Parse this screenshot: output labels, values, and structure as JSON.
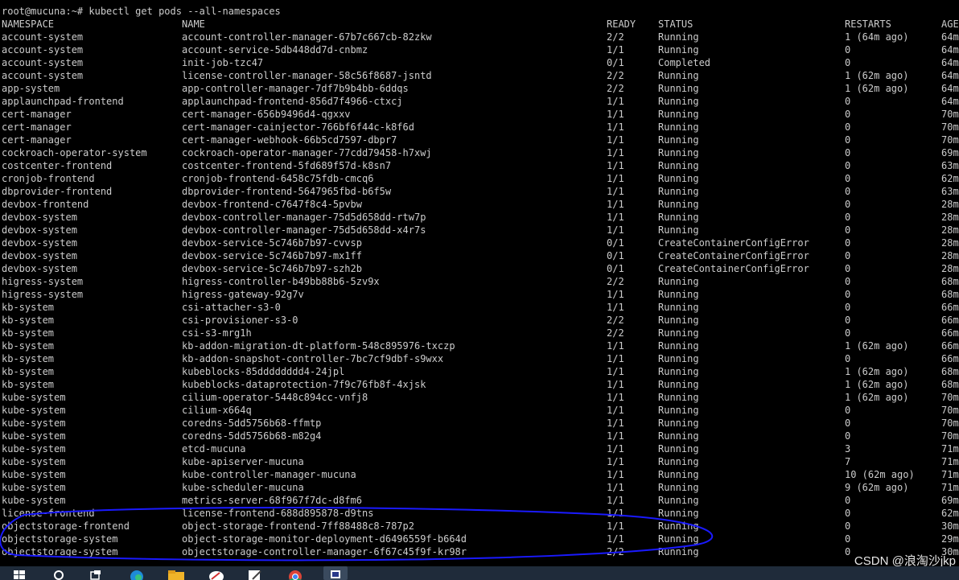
{
  "terminal": {
    "prompt": "root@mucuna:~# kubectl get pods --all-namespaces",
    "headers": {
      "namespace": "NAMESPACE",
      "name": "NAME",
      "ready": "READY",
      "status": "STATUS",
      "restarts": "RESTARTS",
      "age": "AGE"
    },
    "rows": [
      {
        "namespace": "account-system",
        "name": "account-controller-manager-67b7c667cb-82zkw",
        "ready": "2/2",
        "status": "Running",
        "restarts": "1 (64m ago)",
        "age": "64m"
      },
      {
        "namespace": "account-system",
        "name": "account-service-5db448dd7d-cnbmz",
        "ready": "1/1",
        "status": "Running",
        "restarts": "0",
        "age": "64m"
      },
      {
        "namespace": "account-system",
        "name": "init-job-tzc47",
        "ready": "0/1",
        "status": "Completed",
        "restarts": "0",
        "age": "64m"
      },
      {
        "namespace": "account-system",
        "name": "license-controller-manager-58c56f8687-jsntd",
        "ready": "2/2",
        "status": "Running",
        "restarts": "1 (62m ago)",
        "age": "64m"
      },
      {
        "namespace": "app-system",
        "name": "app-controller-manager-7df7b9b4bb-6ddqs",
        "ready": "2/2",
        "status": "Running",
        "restarts": "1 (62m ago)",
        "age": "64m"
      },
      {
        "namespace": "applaunchpad-frontend",
        "name": "applaunchpad-frontend-856d7f4966-ctxcj",
        "ready": "1/1",
        "status": "Running",
        "restarts": "0",
        "age": "64m"
      },
      {
        "namespace": "cert-manager",
        "name": "cert-manager-656b9496d4-qgxxv",
        "ready": "1/1",
        "status": "Running",
        "restarts": "0",
        "age": "70m"
      },
      {
        "namespace": "cert-manager",
        "name": "cert-manager-cainjector-766bf6f44c-k8f6d",
        "ready": "1/1",
        "status": "Running",
        "restarts": "0",
        "age": "70m"
      },
      {
        "namespace": "cert-manager",
        "name": "cert-manager-webhook-66b5cd7597-dbpr7",
        "ready": "1/1",
        "status": "Running",
        "restarts": "0",
        "age": "70m"
      },
      {
        "namespace": "cockroach-operator-system",
        "name": "cockroach-operator-manager-77cdd79458-h7xwj",
        "ready": "1/1",
        "status": "Running",
        "restarts": "0",
        "age": "69m"
      },
      {
        "namespace": "costcenter-frontend",
        "name": "costcenter-frontend-5fd689f57d-k8sn7",
        "ready": "1/1",
        "status": "Running",
        "restarts": "0",
        "age": "63m"
      },
      {
        "namespace": "cronjob-frontend",
        "name": "cronjob-frontend-6458c75fdb-cmcq6",
        "ready": "1/1",
        "status": "Running",
        "restarts": "0",
        "age": "62m"
      },
      {
        "namespace": "dbprovider-frontend",
        "name": "dbprovider-frontend-5647965fbd-b6f5w",
        "ready": "1/1",
        "status": "Running",
        "restarts": "0",
        "age": "63m"
      },
      {
        "namespace": "devbox-frontend",
        "name": "devbox-frontend-c7647f8c4-5pvbw",
        "ready": "1/1",
        "status": "Running",
        "restarts": "0",
        "age": "28m"
      },
      {
        "namespace": "devbox-system",
        "name": "devbox-controller-manager-75d5d658dd-rtw7p",
        "ready": "1/1",
        "status": "Running",
        "restarts": "0",
        "age": "28m"
      },
      {
        "namespace": "devbox-system",
        "name": "devbox-controller-manager-75d5d658dd-x4r7s",
        "ready": "1/1",
        "status": "Running",
        "restarts": "0",
        "age": "28m"
      },
      {
        "namespace": "devbox-system",
        "name": "devbox-service-5c746b7b97-cvvsp",
        "ready": "0/1",
        "status": "CreateContainerConfigError",
        "restarts": "0",
        "age": "28m"
      },
      {
        "namespace": "devbox-system",
        "name": "devbox-service-5c746b7b97-mx1ff",
        "ready": "0/1",
        "status": "CreateContainerConfigError",
        "restarts": "0",
        "age": "28m"
      },
      {
        "namespace": "devbox-system",
        "name": "devbox-service-5c746b7b97-szh2b",
        "ready": "0/1",
        "status": "CreateContainerConfigError",
        "restarts": "0",
        "age": "28m"
      },
      {
        "namespace": "higress-system",
        "name": "higress-controller-b49bb88b6-5zv9x",
        "ready": "2/2",
        "status": "Running",
        "restarts": "0",
        "age": "68m"
      },
      {
        "namespace": "higress-system",
        "name": "higress-gateway-92g7v",
        "ready": "1/1",
        "status": "Running",
        "restarts": "0",
        "age": "68m"
      },
      {
        "namespace": "kb-system",
        "name": "csi-attacher-s3-0",
        "ready": "1/1",
        "status": "Running",
        "restarts": "0",
        "age": "66m"
      },
      {
        "namespace": "kb-system",
        "name": "csi-provisioner-s3-0",
        "ready": "2/2",
        "status": "Running",
        "restarts": "0",
        "age": "66m"
      },
      {
        "namespace": "kb-system",
        "name": "csi-s3-mrg1h",
        "ready": "2/2",
        "status": "Running",
        "restarts": "0",
        "age": "66m"
      },
      {
        "namespace": "kb-system",
        "name": "kb-addon-migration-dt-platform-548c895976-txczp",
        "ready": "1/1",
        "status": "Running",
        "restarts": "1 (62m ago)",
        "age": "66m"
      },
      {
        "namespace": "kb-system",
        "name": "kb-addon-snapshot-controller-7bc7cf9dbf-s9wxx",
        "ready": "1/1",
        "status": "Running",
        "restarts": "0",
        "age": "66m"
      },
      {
        "namespace": "kb-system",
        "name": "kubeblocks-85dddddddd4-24jpl",
        "ready": "1/1",
        "status": "Running",
        "restarts": "1 (62m ago)",
        "age": "68m"
      },
      {
        "namespace": "kb-system",
        "name": "kubeblocks-dataprotection-7f9c76fb8f-4xjsk",
        "ready": "1/1",
        "status": "Running",
        "restarts": "1 (62m ago)",
        "age": "68m"
      },
      {
        "namespace": "kube-system",
        "name": "cilium-operator-5448c894cc-vnfj8",
        "ready": "1/1",
        "status": "Running",
        "restarts": "1 (62m ago)",
        "age": "70m"
      },
      {
        "namespace": "kube-system",
        "name": "cilium-x664q",
        "ready": "1/1",
        "status": "Running",
        "restarts": "0",
        "age": "70m"
      },
      {
        "namespace": "kube-system",
        "name": "coredns-5dd5756b68-ffmtp",
        "ready": "1/1",
        "status": "Running",
        "restarts": "0",
        "age": "70m"
      },
      {
        "namespace": "kube-system",
        "name": "coredns-5dd5756b68-m82g4",
        "ready": "1/1",
        "status": "Running",
        "restarts": "0",
        "age": "70m"
      },
      {
        "namespace": "kube-system",
        "name": "etcd-mucuna",
        "ready": "1/1",
        "status": "Running",
        "restarts": "3",
        "age": "71m"
      },
      {
        "namespace": "kube-system",
        "name": "kube-apiserver-mucuna",
        "ready": "1/1",
        "status": "Running",
        "restarts": "7",
        "age": "71m"
      },
      {
        "namespace": "kube-system",
        "name": "kube-controller-manager-mucuna",
        "ready": "1/1",
        "status": "Running",
        "restarts": "10 (62m ago)",
        "age": "71m"
      },
      {
        "namespace": "kube-system",
        "name": "kube-scheduler-mucuna",
        "ready": "1/1",
        "status": "Running",
        "restarts": "9 (62m ago)",
        "age": "71m"
      },
      {
        "namespace": "kube-system",
        "name": "metrics-server-68f967f7dc-d8fm6",
        "ready": "1/1",
        "status": "Running",
        "restarts": "0",
        "age": "69m"
      },
      {
        "namespace": "license-frontend",
        "name": "license-frontend-688d895878-d9tns",
        "ready": "1/1",
        "status": "Running",
        "restarts": "0",
        "age": "62m"
      },
      {
        "namespace": "objectstorage-frontend",
        "name": "object-storage-frontend-7ff88488c8-787p2",
        "ready": "1/1",
        "status": "Running",
        "restarts": "0",
        "age": "30m"
      },
      {
        "namespace": "objectstorage-system",
        "name": "object-storage-monitor-deployment-d6496559f-b664d",
        "ready": "1/1",
        "status": "Running",
        "restarts": "0",
        "age": "29m"
      },
      {
        "namespace": "objectstorage-system",
        "name": "objectstorage-controller-manager-6f67c45f9f-kr98r",
        "ready": "2/2",
        "status": "Running",
        "restarts": "0",
        "age": "30m"
      }
    ]
  },
  "watermark": "CSDN @浪淘沙jkp",
  "colors": {
    "background": "#000000",
    "text": "#cccccc",
    "annotation": "#1a1aff",
    "taskbar": "#1f2b3a"
  },
  "taskbar": {
    "icons": [
      "windows-start-icon",
      "search-icon",
      "task-view-icon",
      "edge-browser-icon",
      "file-explorer-icon",
      "app-icon",
      "editor-icon",
      "chrome-icon",
      "terminal-icon"
    ]
  }
}
